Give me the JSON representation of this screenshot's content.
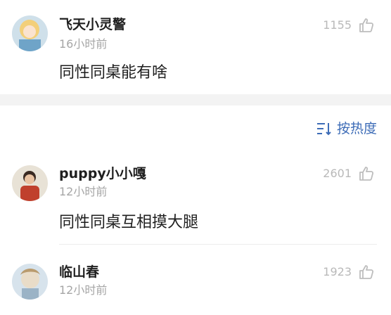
{
  "comments": [
    {
      "user": "飞天小灵警",
      "time": "16小时前",
      "likes": "1155",
      "text": "同性同桌能有啥"
    },
    {
      "user": "puppy小小嘎",
      "time": "12小时前",
      "likes": "2601",
      "text": "同性同桌互相摸大腿"
    },
    {
      "user": "临山春",
      "time": "12小时前",
      "likes": "1923",
      "text": ""
    }
  ],
  "sort": {
    "label": "按热度"
  },
  "colors": {
    "accent": "#3d6cb7",
    "muted": "#a6a6a6",
    "separator": "#f3f3f3"
  },
  "icons": [
    "like-thumb-icon",
    "sort-icon"
  ]
}
